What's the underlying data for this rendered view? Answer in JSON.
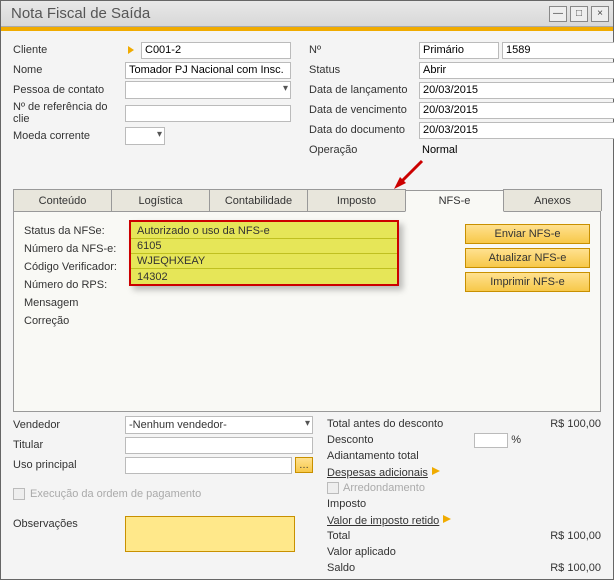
{
  "window": {
    "title": "Nota Fiscal de Saída"
  },
  "left": {
    "cliente_label": "Cliente",
    "cliente": "C001-2",
    "nome_label": "Nome",
    "nome": "Tomador PJ Nacional com Insc.",
    "pessoa_label": "Pessoa de contato",
    "pessoa": "",
    "ref_label": "Nº de referência do clie",
    "ref": "",
    "moeda_label": "Moeda corrente",
    "moeda": ""
  },
  "right": {
    "no_label": "Nº",
    "no_type": "Primário",
    "no_val": "1589",
    "status_label": "Status",
    "status": "Abrir",
    "lanc_label": "Data de lançamento",
    "lanc": "20/03/2015",
    "venc_label": "Data de vencimento",
    "venc": "20/03/2015",
    "doc_label": "Data do documento",
    "doc": "20/03/2015",
    "oper_label": "Operação",
    "oper": "Normal"
  },
  "tabs": {
    "t0": "Conteúdo",
    "t1": "Logística",
    "t2": "Contabilidade",
    "t3": "Imposto",
    "t4": "NFS-e",
    "t5": "Anexos"
  },
  "nfse": {
    "status_label": "Status da NFSe:",
    "status": "Autorizado o uso da NFS-e",
    "numero_label": "Número da NFS-e:",
    "numero": "6105",
    "cod_label": "Código Verificador:",
    "cod": "WJEQHXEAY",
    "rps_label": "Número do RPS:",
    "rps": "14302",
    "msg_label": "Mensagem",
    "cor_label": "Correção",
    "btn_enviar": "Enviar NFS-e",
    "btn_atualizar": "Atualizar NFS-e",
    "btn_imprimir": "Imprimir NFS-e"
  },
  "lower": {
    "vend_label": "Vendedor",
    "vend": "-Nenhum vendedor-",
    "titular_label": "Titular",
    "titular": "",
    "uso_label": "Uso principal",
    "uso": "",
    "exec_label": "Execução da ordem de pagamento",
    "obs_label": "Observações"
  },
  "totals": {
    "antes_label": "Total antes do desconto",
    "antes": "R$ 100,00",
    "desc_label": "Desconto",
    "desc_pct": "",
    "pct_sym": "%",
    "adiant_label": "Adiantamento total",
    "desp_label": "Despesas adicionais",
    "arred_label": "Arredondamento",
    "imp_label": "Imposto",
    "ret_label": "Valor de imposto retido",
    "total_label": "Total",
    "total": "R$ 100,00",
    "aplic_label": "Valor aplicado",
    "saldo_label": "Saldo",
    "saldo": "R$ 100,00"
  }
}
